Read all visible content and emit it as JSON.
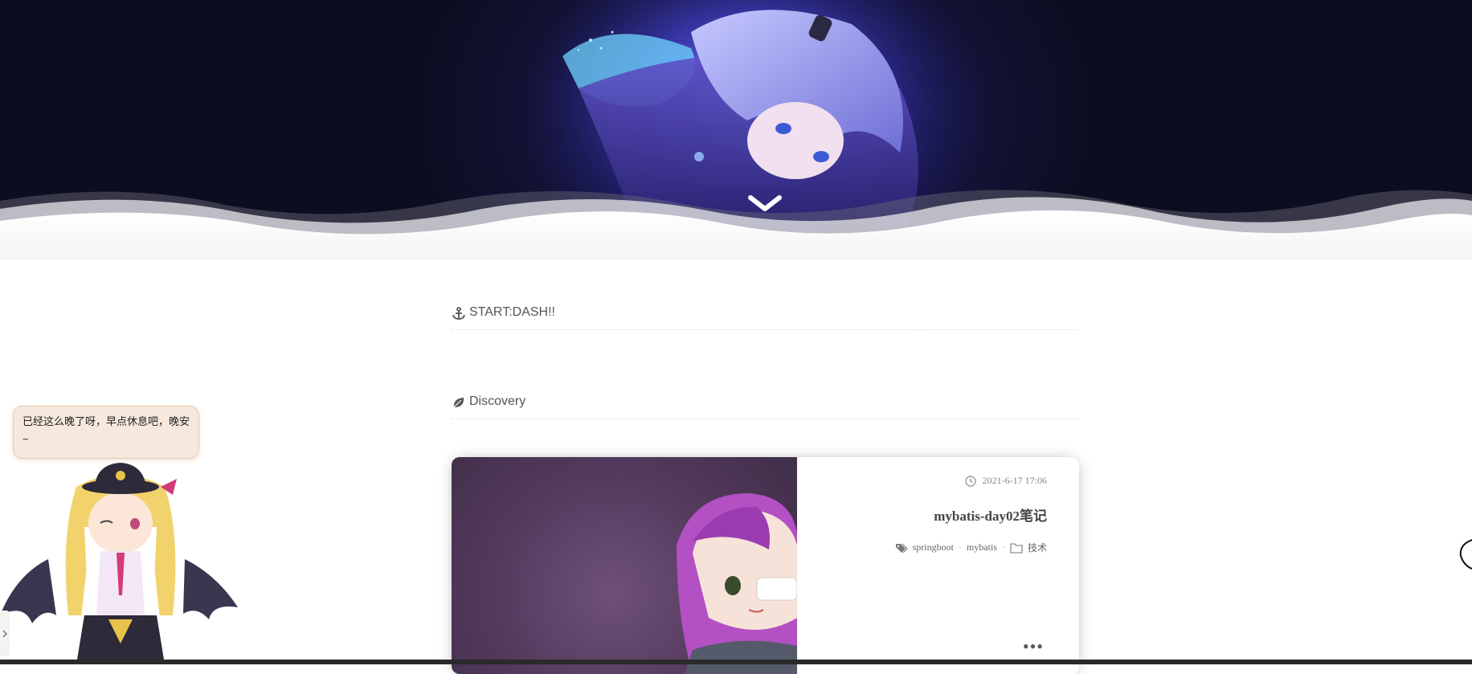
{
  "hero": {
    "scroll_icon": "chevron-down-icon",
    "colors": {
      "background": "#121233",
      "glow": "#3a3fb8"
    }
  },
  "sections": {
    "start": {
      "icon": "anchor-icon",
      "title": "START:DASH!!"
    },
    "discovery": {
      "icon": "leaf-icon",
      "title": "Discovery"
    }
  },
  "post": {
    "date_icon": "clock-icon",
    "date": "2021-6-17 17:06",
    "title": "mybatis-day02笔记",
    "tags_icon": "tags-icon",
    "tags": [
      "springboot",
      "mybatis"
    ],
    "separator": "·",
    "category_icon": "folder-icon",
    "category": "技术",
    "more": "•••"
  },
  "mascot": {
    "message": "已经这么晚了呀，早点休息吧，晚安~",
    "toggle_icon": "chevron-right-icon"
  }
}
